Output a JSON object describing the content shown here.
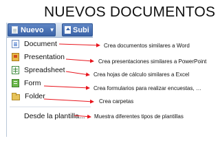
{
  "slide": {
    "title": "NUEVOS DOCUMENTOS"
  },
  "toolbar": {
    "new_button_label": "Nuevo",
    "upload_button_label": "Subi"
  },
  "menu": {
    "items": [
      {
        "label": "Document",
        "icon": "document-icon"
      },
      {
        "label": "Presentation",
        "icon": "presentation-icon"
      },
      {
        "label": "Spreadsheet",
        "icon": "spreadsheet-icon"
      },
      {
        "label": "Form",
        "icon": "form-icon"
      },
      {
        "label": "Folder",
        "icon": "folder-icon"
      },
      {
        "label": "Desde la plantilla...",
        "icon": ""
      }
    ]
  },
  "callouts": [
    "Crea documentos similares a Word",
    "Crea presentaciones similares a PowerPoint",
    "Crea hojas de cálculo similares a Excel",
    "Crea formularios para realizar encuestas, …",
    "Crea carpetas",
    "Muestra diferentes tipos de plantillas"
  ],
  "colors": {
    "arrow": "#e8141c",
    "accent": "#3a63a7"
  }
}
